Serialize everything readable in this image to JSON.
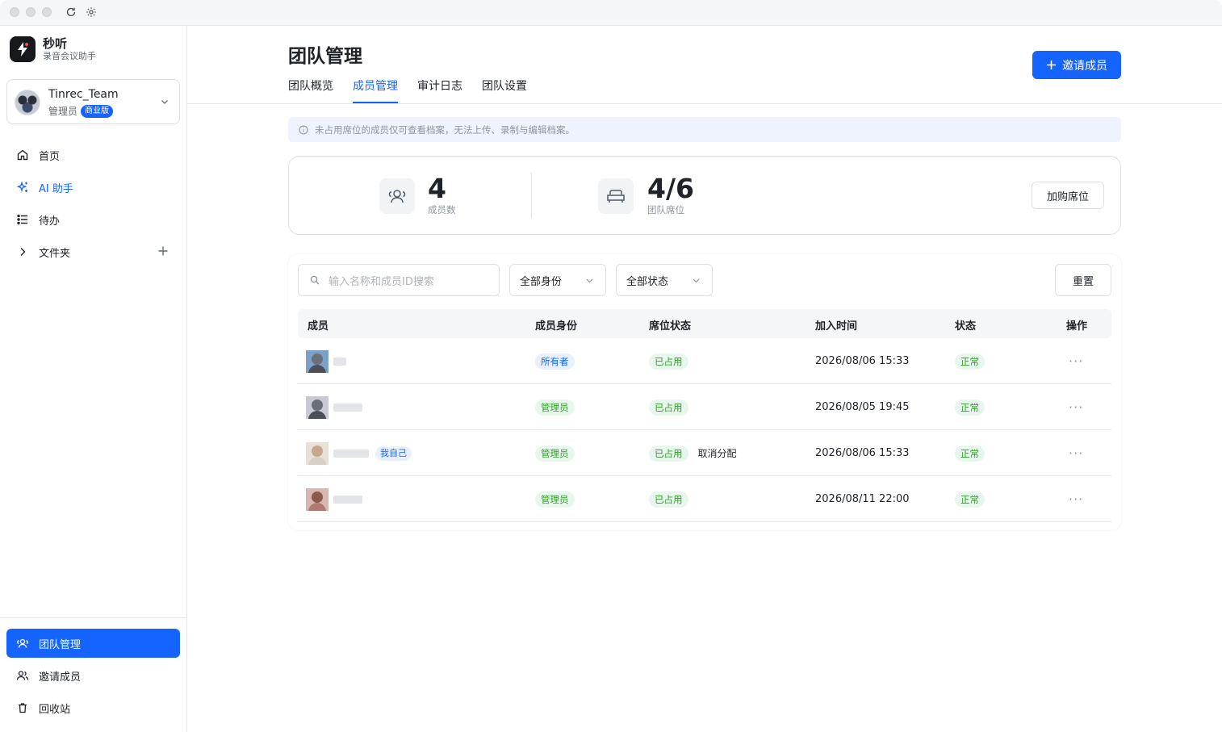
{
  "sidebar": {
    "brand": {
      "name": "秒听",
      "subtitle": "录音会议助手"
    },
    "team": {
      "name": "Tinrec_Team",
      "role": "管理员",
      "plan_badge": "商业版"
    },
    "nav": [
      {
        "label": "首页",
        "icon": "home-icon"
      },
      {
        "label": "AI 助手",
        "icon": "sparkle-icon"
      },
      {
        "label": "待办",
        "icon": "todo-list-icon"
      },
      {
        "label": "文件夹",
        "icon": "chevron-right-icon"
      }
    ],
    "bottom_nav": [
      {
        "label": "团队管理",
        "icon": "team-icon"
      },
      {
        "label": "邀请成员",
        "icon": "invite-users-icon"
      },
      {
        "label": "回收站",
        "icon": "trash-icon"
      }
    ]
  },
  "main": {
    "title": "团队管理",
    "tabs": [
      {
        "label": "团队概览"
      },
      {
        "label": "成员管理"
      },
      {
        "label": "审计日志"
      },
      {
        "label": "团队设置"
      }
    ],
    "invite_button": "邀请成员",
    "notice": "未占用席位的成员仅可查看档案，无法上传、录制与编辑档案。",
    "stats": {
      "members_value": "4",
      "members_label": "成员数",
      "seats_value": "4/6",
      "seats_label": "团队席位",
      "buy_button": "加购席位"
    },
    "filters": {
      "search_placeholder": "输入名称和成员ID搜索",
      "role_select": "全部身份",
      "status_select": "全部状态",
      "reset_button": "重置"
    },
    "table": {
      "headers": [
        "成员",
        "成员身份",
        "席位状态",
        "加入时间",
        "状态",
        "操作"
      ],
      "rows": [
        {
          "role": "所有者",
          "seat": "已占用",
          "joined": "2026/08/06 15:33",
          "status": "正常",
          "more": "···"
        },
        {
          "role": "管理员",
          "seat": "已占用",
          "joined": "2026/08/05 19:45",
          "status": "正常",
          "more": "···"
        },
        {
          "role": "管理员",
          "seat": "已占用",
          "seat_action": "取消分配",
          "self_tag": "我自己",
          "joined": "2026/08/06 15:33",
          "status": "正常",
          "more": "···"
        },
        {
          "role": "管理员",
          "seat": "已占用",
          "joined": "2026/08/11 22:00",
          "status": "正常",
          "more": "···"
        }
      ]
    }
  },
  "colors": {
    "accent": "#1664ff",
    "success": "#2ea121",
    "notice_bg": "#eef3fe"
  }
}
